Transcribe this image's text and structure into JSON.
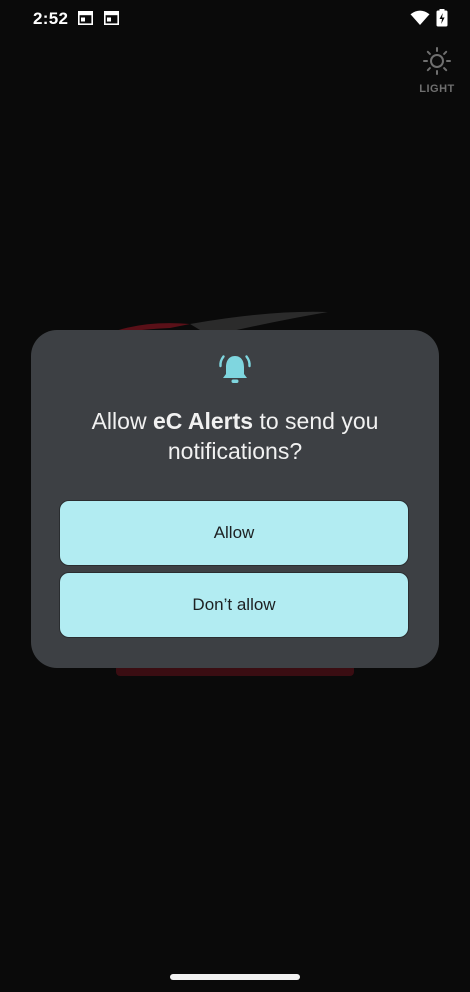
{
  "status_bar": {
    "time": "2:52"
  },
  "light_toggle": {
    "label": "LIGHT"
  },
  "dialog": {
    "title_prefix": "Allow ",
    "app_name": "eC Alerts",
    "title_suffix": " to send you notifications?",
    "allow_label": "Allow",
    "deny_label": "Don’t allow",
    "icon": "bell-ringing-icon"
  },
  "colors": {
    "accent": "#b2ecf2",
    "dialog_bg": "#3d4044",
    "icon": "#7fd6df"
  }
}
